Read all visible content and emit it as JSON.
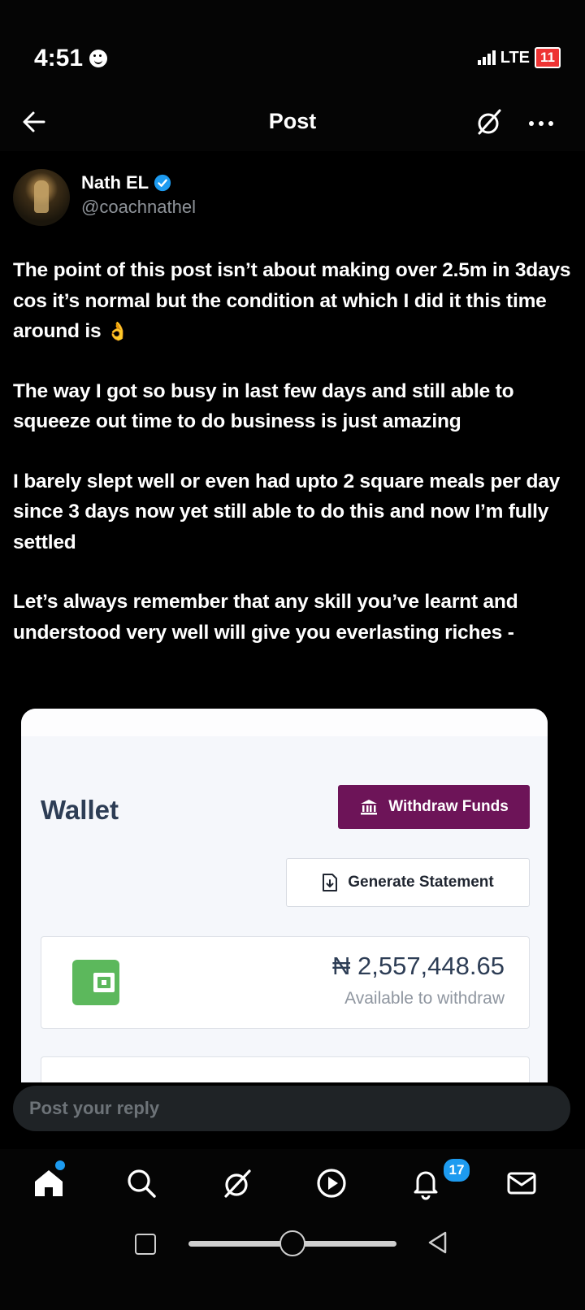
{
  "status": {
    "time": "4:51",
    "network": "LTE",
    "battery": "11"
  },
  "header": {
    "title": "Post"
  },
  "author": {
    "name": "Nath EL",
    "handle": "@coachnathel"
  },
  "post": {
    "paragraphs": [
      "The point of this post isn’t about making over 2.5m in 3days cos it’s normal but the condition at which I did it this time around is",
      "The way I got so busy in last few days and still able to squeeze out time to do business is just amazing",
      "I barely slept well or even had upto 2 square meals per day since 3 days now yet still able to do this and now I’m fully settled",
      "Let’s always remember that any skill you’ve learnt and understood very well will give you everlasting riches -"
    ],
    "emoji": "👌"
  },
  "wallet": {
    "title": "Wallet",
    "withdraw_label": "Withdraw Funds",
    "statement_label": "Generate Statement",
    "amount": "₦ 2,557,448.65",
    "amount_sub": "Available to withdraw",
    "accent_color": "#6d1458",
    "wallet_icon_color": "#5cb85c"
  },
  "reply": {
    "placeholder": "Post your reply"
  },
  "nav": {
    "notification_count": "17",
    "items": [
      "home-icon",
      "search-icon",
      "grok-icon",
      "video-icon",
      "notifications-icon",
      "messages-icon"
    ]
  }
}
